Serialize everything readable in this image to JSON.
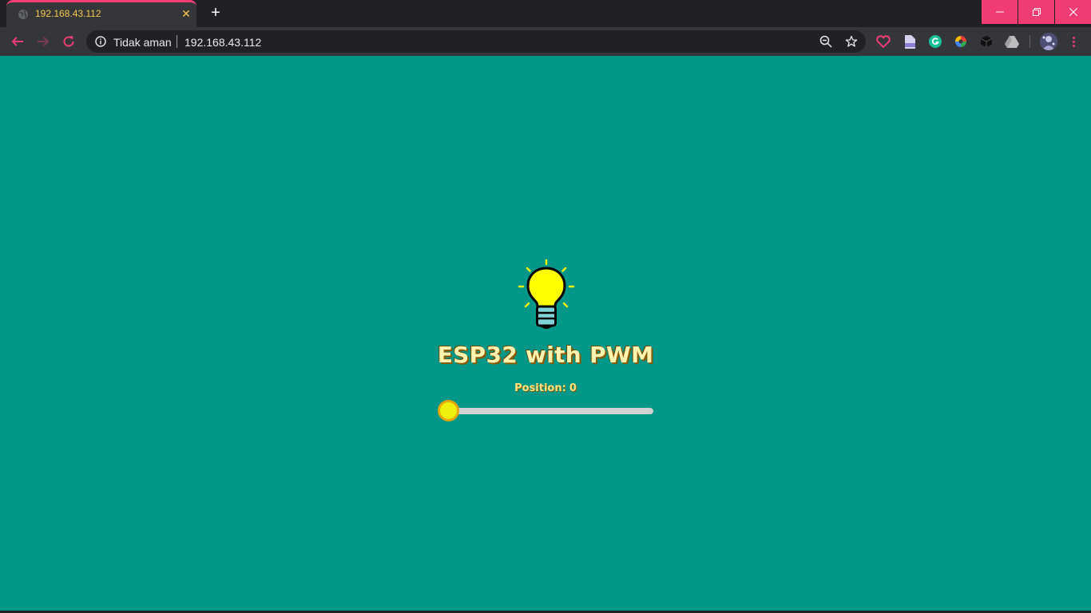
{
  "browser": {
    "tab": {
      "title": "192.168.43.112",
      "close": "✕"
    },
    "new_tab": "+",
    "omnibox": {
      "security_label": "Tidak aman",
      "url": "192.168.43.112"
    },
    "accent_color": "#f13d74",
    "extensions": [
      "heart-icon",
      "pdf-icon",
      "grammarly-icon",
      "color-wheel-icon",
      "cube-icon",
      "drive-icon"
    ]
  },
  "page": {
    "background": "#009688",
    "title": "ESP32 with PWM",
    "position_label": "Position:",
    "position_value": "0",
    "slider": {
      "value": 0,
      "min": 0,
      "max": 255
    }
  }
}
